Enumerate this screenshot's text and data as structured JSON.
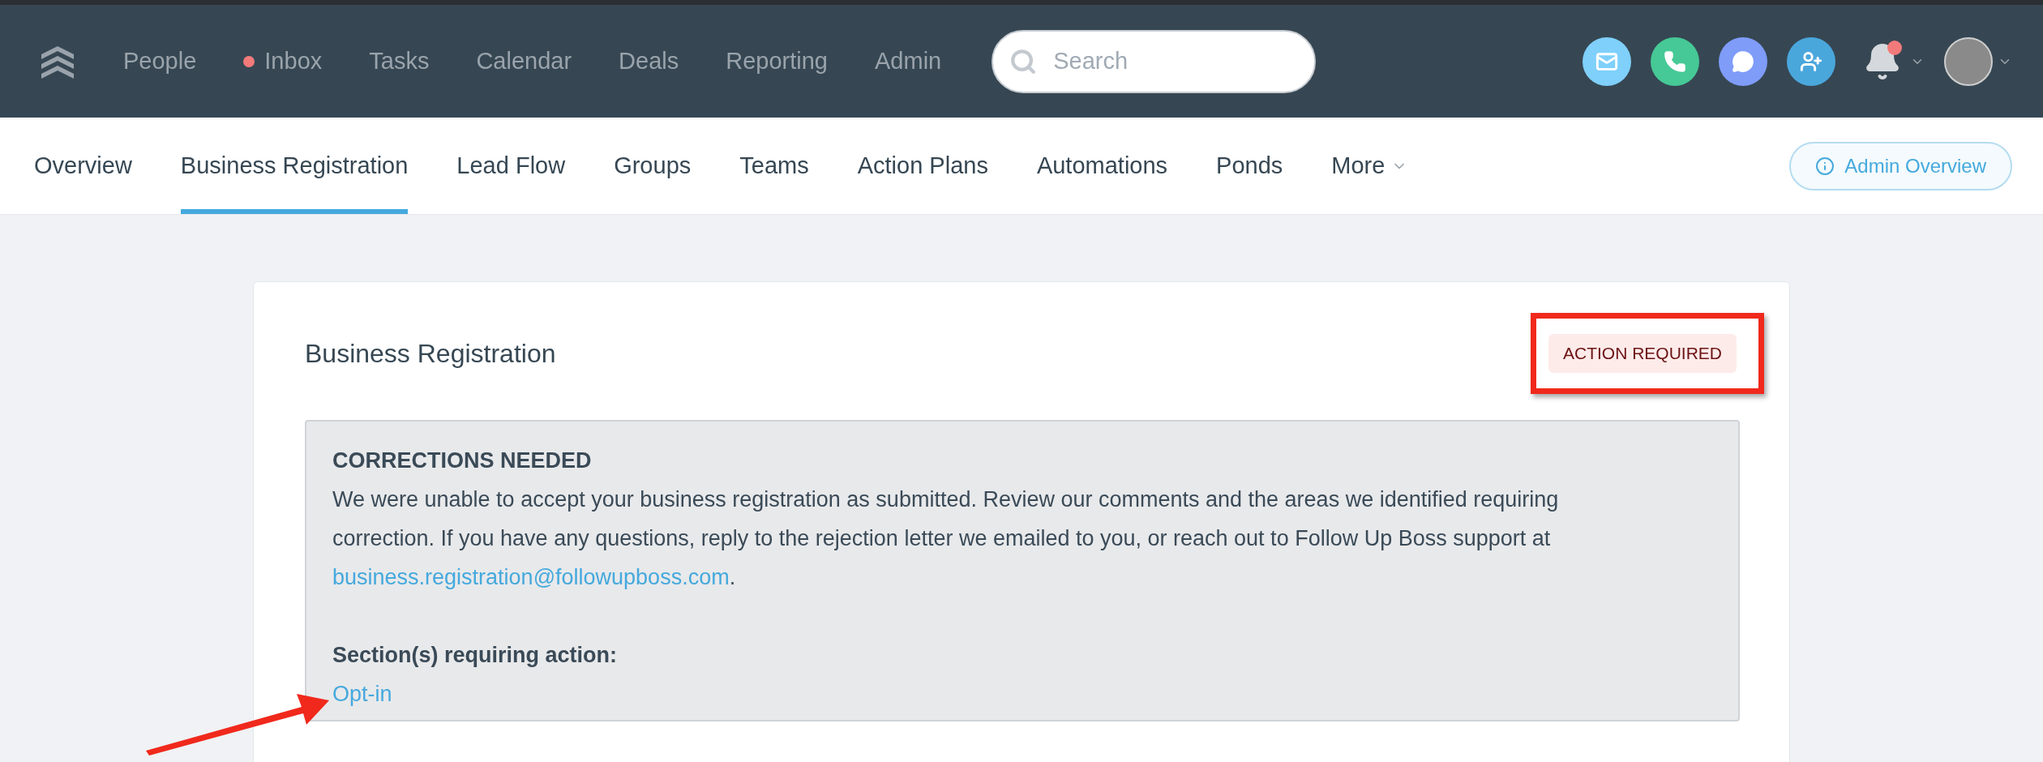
{
  "top_nav": {
    "items": [
      {
        "label": "People",
        "dot": false
      },
      {
        "label": "Inbox",
        "dot": true
      },
      {
        "label": "Tasks",
        "dot": false
      },
      {
        "label": "Calendar",
        "dot": false
      },
      {
        "label": "Deals",
        "dot": false
      },
      {
        "label": "Reporting",
        "dot": false
      },
      {
        "label": "Admin",
        "dot": false
      }
    ],
    "search": {
      "placeholder": "Search"
    },
    "notifications": {
      "unread": true
    }
  },
  "tabs": [
    {
      "label": "Overview",
      "selected": false
    },
    {
      "label": "Business Registration",
      "selected": true
    },
    {
      "label": "Lead Flow",
      "selected": false
    },
    {
      "label": "Groups",
      "selected": false
    },
    {
      "label": "Teams",
      "selected": false
    },
    {
      "label": "Action Plans",
      "selected": false
    },
    {
      "label": "Automations",
      "selected": false
    },
    {
      "label": "Ponds",
      "selected": false
    },
    {
      "label": "More",
      "selected": false
    }
  ],
  "admin_button": "Admin Overview",
  "card": {
    "title": "Business Registration",
    "status": "ACTION REQUIRED",
    "notice": {
      "heading": "CORRECTIONS NEEDED",
      "body": "We were unable to accept your business registration as submitted. Review our comments and the areas we identified requiring correction. If you have any questions, reply to the rejection letter we emailed to you, or reach out to Follow Up Boss support at",
      "email": "business.registration@followupboss.com",
      "after_email": ".",
      "sections_heading": "Section(s) requiring action:",
      "sections": [
        "Opt-in"
      ]
    }
  }
}
